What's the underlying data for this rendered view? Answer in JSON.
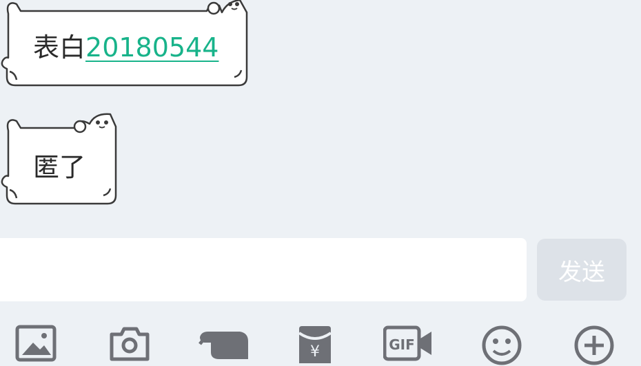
{
  "messages": [
    {
      "prefix": "表白",
      "link": "20180544"
    },
    {
      "text": "匿了"
    }
  ],
  "composer": {
    "placeholder": "",
    "send_label": "发送"
  },
  "toolbar": {
    "items": [
      "image-icon",
      "camera-icon",
      "poke-icon",
      "red-packet-icon",
      "gif-icon",
      "emoji-icon",
      "plus-icon"
    ]
  },
  "colors": {
    "background": "#edf1f5",
    "link": "#18b38a",
    "send_button_bg": "#dde2e8",
    "icon_gray": "#6e7076"
  }
}
